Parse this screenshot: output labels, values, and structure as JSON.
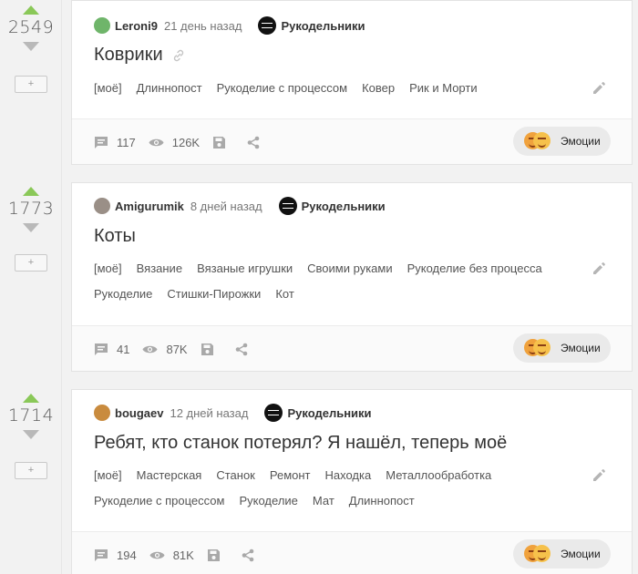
{
  "colors": {
    "upvote": "#8ac858",
    "downvote": "#b9b9b9"
  },
  "labels": {
    "emotions": "Эмоции",
    "add_to_favorites": "+"
  },
  "stories": [
    {
      "rating": "2549",
      "author": "Leroni9",
      "author_avatar": "green-cat-avatar",
      "date": "21 день назад",
      "community": "Рукодельники",
      "title": "Коврики",
      "has_link_icon": true,
      "tags": [
        "[моё]",
        "Длиннопост",
        "Рукоделие с процессом",
        "Ковер",
        "Рик и Морти"
      ],
      "comments": "117",
      "views": "126K"
    },
    {
      "rating": "1773",
      "author": "Amigurumik",
      "author_avatar": "knitting-avatar",
      "date": "8 дней назад",
      "community": "Рукодельники",
      "title": "Коты",
      "has_link_icon": false,
      "tags": [
        "[моё]",
        "Вязание",
        "Вязаные игрушки",
        "Своими руками",
        "Рукоделие без процесса",
        "Рукоделие",
        "Стишки-Пирожки",
        "Кот"
      ],
      "comments": "41",
      "views": "87K"
    },
    {
      "rating": "1714",
      "author": "bougaev",
      "author_avatar": "photo-avatar",
      "date": "12 дней назад",
      "community": "Рукодельники",
      "title": "Ребят, кто станок потерял? Я нашёл, теперь моё",
      "has_link_icon": false,
      "tags": [
        "[моё]",
        "Мастерская",
        "Станок",
        "Ремонт",
        "Находка",
        "Металлообработка",
        "Рукоделие с процессом",
        "Рукоделие",
        "Мат",
        "Длиннопост"
      ],
      "comments": "194",
      "views": "81K"
    }
  ]
}
